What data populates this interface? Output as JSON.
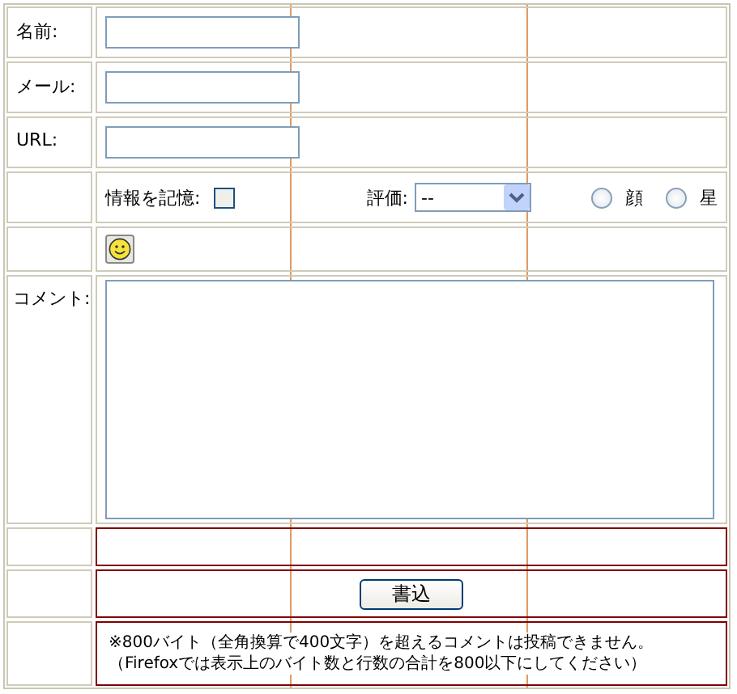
{
  "fields": [
    {
      "label": "名前:"
    },
    {
      "label": "メール:"
    },
    {
      "label": "URL:"
    }
  ],
  "remember": {
    "label": "情報を記憶:",
    "checked": false
  },
  "rating": {
    "label": "評価:",
    "value": "--"
  },
  "icon_modes": [
    {
      "label": "顔",
      "selected": false
    },
    {
      "label": "星",
      "selected": false
    }
  ],
  "comment": {
    "label": "コメント:"
  },
  "submit": "書込",
  "notes": [
    "※800バイト（全角換算で400文字）を超えるコメントは投稿できません。",
    "（Firefoxでは表示上のバイト数と行数の合計を800以下にしてください）"
  ]
}
